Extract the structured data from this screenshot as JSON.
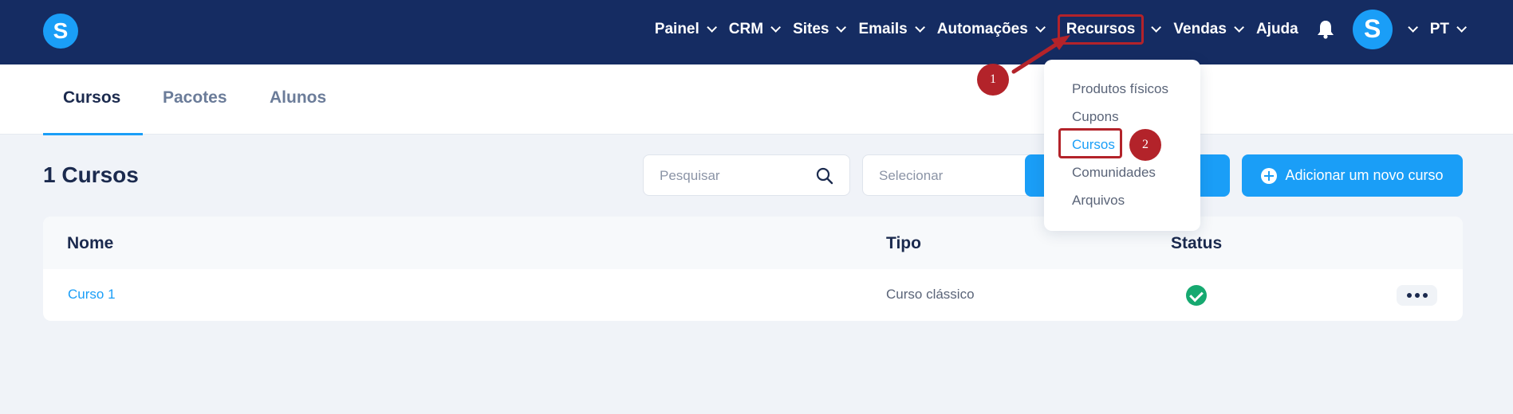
{
  "colors": {
    "navbar": "#152c62",
    "accent": "#1a9ef7",
    "annotation": "#b3232a",
    "success": "#16a970"
  },
  "logo": {
    "letter": "S"
  },
  "nav": {
    "items": [
      {
        "label": "Painel",
        "icon": "chevron-down-icon"
      },
      {
        "label": "CRM",
        "icon": "chevron-down-icon"
      },
      {
        "label": "Sites",
        "icon": "chevron-down-icon"
      },
      {
        "label": "Emails",
        "icon": "chevron-down-icon"
      },
      {
        "label": "Automações",
        "icon": "chevron-down-icon"
      },
      {
        "label": "Recursos",
        "icon": "chevron-down-icon"
      },
      {
        "label": "Vendas",
        "icon": "chevron-down-icon"
      },
      {
        "label": "Ajuda"
      }
    ],
    "bell_icon": "bell-icon",
    "avatar_letter": "S",
    "language": "PT"
  },
  "tabs": [
    {
      "label": "Cursos",
      "active": true
    },
    {
      "label": "Pacotes"
    },
    {
      "label": "Alunos"
    }
  ],
  "page": {
    "title": "1 Cursos"
  },
  "search": {
    "placeholder": "Pesquisar",
    "icon": "search-icon"
  },
  "filter": {
    "placeholder": "Selecionar"
  },
  "add_button": {
    "label": "Adicionar um novo curso",
    "icon": "plus-circle-icon"
  },
  "table": {
    "headers": {
      "name": "Nome",
      "type": "Tipo",
      "status": "Status"
    },
    "rows": [
      {
        "name": "Curso 1",
        "type": "Curso clássico",
        "status": "check-circle-icon",
        "actions": "more-icon"
      }
    ]
  },
  "dropdown": {
    "items": [
      "Produtos físicos",
      "Cupons",
      "Cursos",
      "Comunidades",
      "Arquivos"
    ],
    "active": "Cursos"
  },
  "annotations": {
    "step1": "1",
    "step2": "2"
  }
}
